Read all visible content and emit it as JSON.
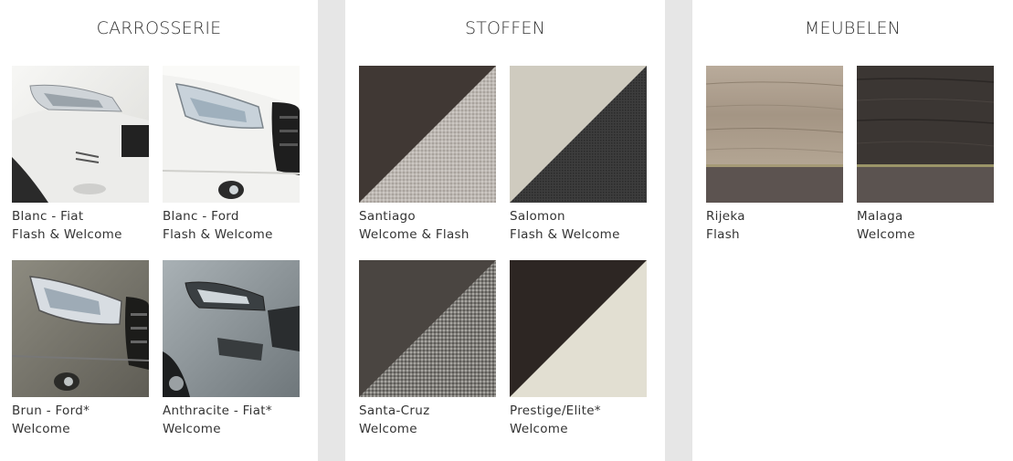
{
  "panels": [
    {
      "title": "CARROSSERIE",
      "items": [
        {
          "name": "Blanc - Fiat",
          "variant": "Flash & Welcome"
        },
        {
          "name": "Blanc - Ford",
          "variant": "Flash & Welcome"
        },
        {
          "name": "Brun - Ford*",
          "variant": "Welcome"
        },
        {
          "name": "Anthracite - Fiat*",
          "variant": "Welcome"
        }
      ]
    },
    {
      "title": "STOFFEN",
      "items": [
        {
          "name": "Santiago",
          "variant": "Welcome & Flash"
        },
        {
          "name": "Salomon",
          "variant": "Flash & Welcome"
        },
        {
          "name": "Santa-Cruz",
          "variant": "Welcome"
        },
        {
          "name": "Prestige/Elite*",
          "variant": "Welcome"
        }
      ]
    },
    {
      "title": "MEUBELEN",
      "items": [
        {
          "name": "Rijeka",
          "variant": "Flash"
        },
        {
          "name": "Malaga",
          "variant": "Welcome"
        }
      ]
    }
  ],
  "colors": {
    "background": "#e6e6e6",
    "panel": "#ffffff",
    "text": "#333333"
  }
}
